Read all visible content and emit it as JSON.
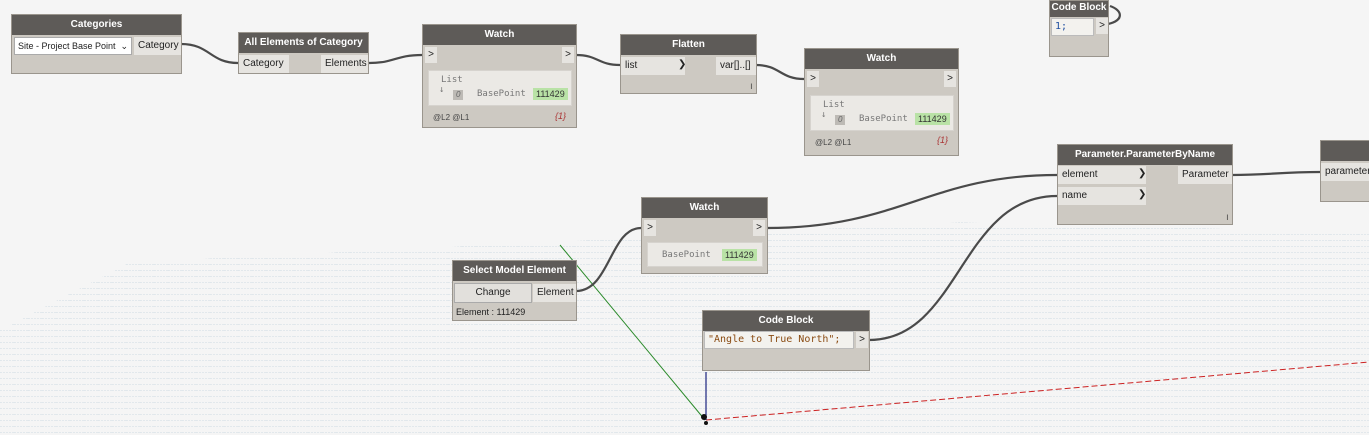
{
  "colors": {
    "wire": "#4a4a4a",
    "header": "#5e5b58",
    "node_body": "#cdc9c2",
    "value_green": "#b9e2a6",
    "grid": "#9bb7c9",
    "axis_x": "#cc2222",
    "axis_y": "#2a8a2a"
  },
  "nodes": {
    "categories": {
      "title": "Categories",
      "dropdown": "Site - Project Base Point",
      "output": "Category"
    },
    "all_elements": {
      "title": "All Elements of Category",
      "input": "Category",
      "output": "Elements"
    },
    "watch1": {
      "title": "Watch",
      "in": ">",
      "out": ">",
      "list_label": "List",
      "index": "0",
      "item": "BasePoint",
      "value": "111429",
      "levels": "@L2 @L1",
      "count": "{1}"
    },
    "flatten": {
      "title": "Flatten",
      "input": "list",
      "output": "var[]..[]",
      "lacing": "l"
    },
    "watch2": {
      "title": "Watch",
      "in": ">",
      "out": ">",
      "list_label": "List",
      "index": "0",
      "item": "BasePoint",
      "value": "111429",
      "levels": "@L2 @L1",
      "count": "{1}"
    },
    "code_block_top": {
      "title": "Code Block",
      "code": "1;",
      "out": ">"
    },
    "param_by_name": {
      "title": "Parameter.ParameterByName",
      "input1": "element",
      "input2": "name",
      "output": "Parameter",
      "lacing": "l"
    },
    "partial_node": {
      "title": "",
      "input": "parameter"
    },
    "watch3": {
      "title": "Watch",
      "in": ">",
      "out": ">",
      "item": "BasePoint",
      "value": "111429"
    },
    "select_model": {
      "title": "Select Model Element",
      "button": "Change",
      "output": "Element",
      "status": "Element : 111429"
    },
    "code_block_bottom": {
      "title": "Code Block",
      "code": "\"Angle to True North\";",
      "out": ">"
    }
  }
}
